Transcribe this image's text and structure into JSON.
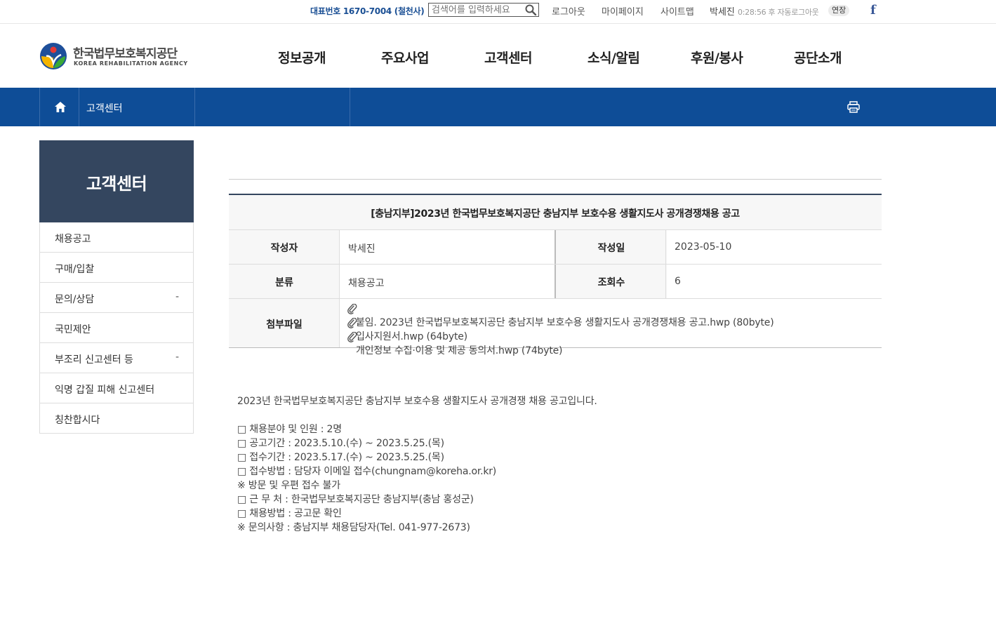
{
  "topbar": {
    "phone": "대표번호 1670-7004 (철천사)",
    "search_placeholder": "검색어를 입력하세요",
    "links": [
      "로그아웃",
      "마이페이지",
      "사이트맵"
    ],
    "user_name": "박세진",
    "logout_timer": "0:28:56 후 자동로그아웃",
    "extend_label": "연장",
    "facebook_label": "f"
  },
  "logo": {
    "name_ko": "한국법무보호복지공단",
    "name_en": "KOREA REHABILITATION AGENCY"
  },
  "gnb": [
    "정보공개",
    "주요사업",
    "고객센터",
    "소식/알림",
    "후원/봉사",
    "공단소개"
  ],
  "location": {
    "current": "고객센터"
  },
  "lnb": {
    "title": "고객센터",
    "items": [
      {
        "label": "채용공고",
        "expand": ""
      },
      {
        "label": "구매/입찰",
        "expand": ""
      },
      {
        "label": "문의/상담",
        "expand": "-"
      },
      {
        "label": "국민제안",
        "expand": ""
      },
      {
        "label": "부조리 신고센터 등",
        "expand": "-"
      },
      {
        "label": "익명 갑질 피해 신고센터",
        "expand": ""
      },
      {
        "label": "칭찬합시다",
        "expand": ""
      }
    ]
  },
  "article": {
    "title": "[충남지부]2023년 한국법무보호복지공단 충남지부 보호수용 생활지도사 공개경쟁채용 공고",
    "author_label": "작성자",
    "author": "박세진",
    "date_label": "작성일",
    "date": "2023-05-10",
    "category_label": "분류",
    "category": "채용공고",
    "views_label": "조회수",
    "views": "6",
    "files_label": "첨부파일",
    "files": [
      "붙임. 2023년 한국법무보호복지공단 충남지부 보호수용 생활지도사 공개경쟁채용 공고.hwp (80byte)",
      "입사지원서.hwp (64byte)",
      "개인정보 수집·이용 및 제공 동의서.hwp (74byte)"
    ]
  },
  "content": {
    "intro": "2023년 한국법무보호복지공단 충남지부 보호수용 생활지도사 공개경쟁 채용 공고입니다.",
    "lines": [
      "□ 채용분야 및 인원 : 2명",
      "□ 공고기간 : 2023.5.10.(수) ~ 2023.5.25.(목)",
      "□ 접수기간 : 2023.5.17.(수) ~ 2023.5.25.(목)",
      "□ 접수방법 : 담당자 이메일 접수(chungnam@koreha.or.kr)",
      "※ 방문 및 우편 접수 불가",
      "□ 근 무 처 : 한국법무보호복지공단 충남지부(충남 홍성군)",
      "□ 채용방법 : 공고문 확인",
      "※ 문의사항 : 충남지부 채용담당자(Tel. 041-977-2673)"
    ]
  },
  "colors": {
    "brand_blue": "#0e4d97",
    "nav_title_bg": "#34465f",
    "phone_text": "#1a4f94",
    "facebook": "#3b5998"
  }
}
